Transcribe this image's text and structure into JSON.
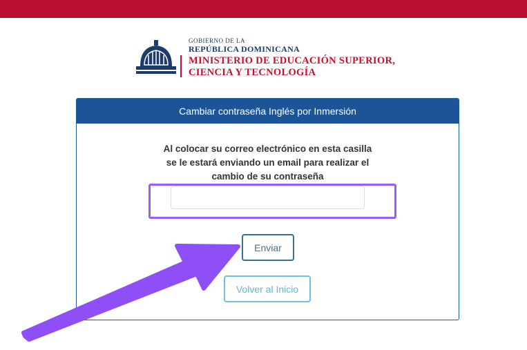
{
  "header": {
    "gov_line": "GOBIERNO DE LA",
    "republic_line": "REPÚBLICA DOMINICANA",
    "ministry_line1": "MINISTERIO DE EDUCACIÓN SUPERIOR,",
    "ministry_line2": "CIENCIA Y TECNOLOGÍA"
  },
  "card": {
    "title": "Cambiar contraseña Inglés por Inmersión",
    "instructions": [
      "Al colocar su correo electrónico en esta casilla",
      "se le estará enviando un email para realizar el",
      "cambio de su contraseña"
    ],
    "email_value": "",
    "email_placeholder": "",
    "send_label": "Enviar",
    "back_label": "Volver al Inicio"
  },
  "colors": {
    "top_bar": "#b80f2e",
    "card_header": "#1c5597",
    "highlight": "#9b5cf5",
    "arrow": "#8e4ff7"
  }
}
